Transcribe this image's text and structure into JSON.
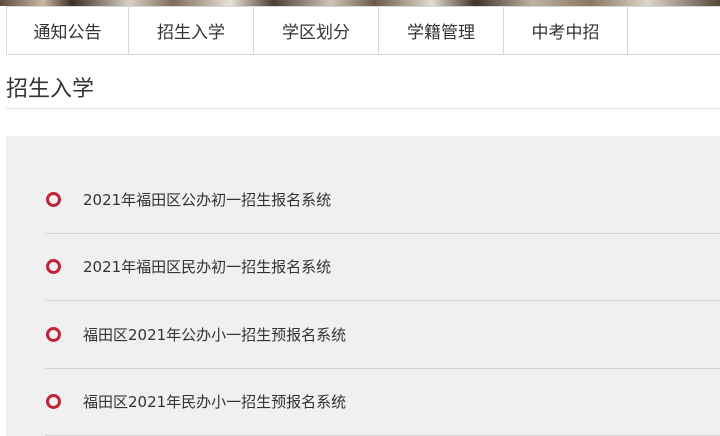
{
  "nav": {
    "tabs": [
      {
        "label": "通知公告"
      },
      {
        "label": "招生入学"
      },
      {
        "label": "学区划分"
      },
      {
        "label": "学籍管理"
      },
      {
        "label": "中考中招"
      }
    ]
  },
  "section": {
    "title": "招生入学"
  },
  "links": [
    {
      "label": "2021年福田区公办初一招生报名系统"
    },
    {
      "label": "2021年福田区民办初一招生报名系统"
    },
    {
      "label": "福田区2021年公办小一招生预报名系统"
    },
    {
      "label": "福田区2021年民办小一招生预报名系统"
    }
  ],
  "colors": {
    "accent": "#c0243a",
    "panel_bg": "#f0f0f0",
    "divider": "#d4d4d4"
  }
}
